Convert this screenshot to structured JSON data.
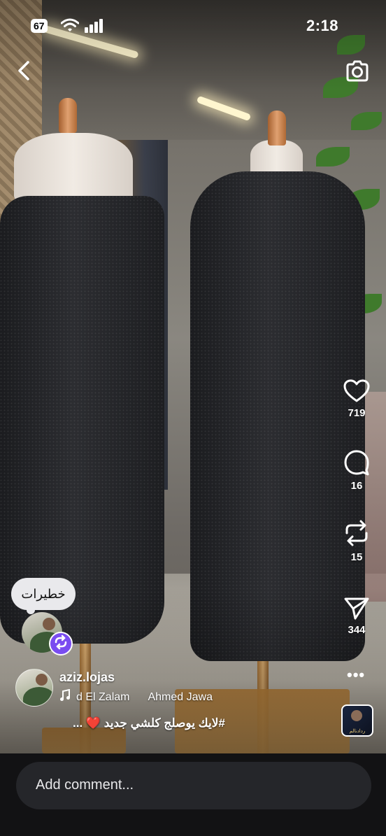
{
  "status_bar": {
    "battery": "67",
    "time": "2:18"
  },
  "top_bar": {
    "back_icon": "chevron-left-icon",
    "camera_icon": "camera-icon"
  },
  "actions": {
    "likes": "719",
    "comments": "16",
    "reposts": "15",
    "shares": "344"
  },
  "note": {
    "text": "خطيرات"
  },
  "author": {
    "username": "aziz.lojas"
  },
  "audio": {
    "segments": [
      "d El Zalam",
      "Ahmed Jawa"
    ],
    "thumb_text": "ردادنالم"
  },
  "caption": {
    "text": "#لايك يوصلج كلشي جديد ❤️ ..."
  },
  "comment": {
    "placeholder": "Add comment..."
  },
  "colors": {
    "remix_badge": "#7a4cf0",
    "comment_bar": "#121214",
    "comment_input": "#25262a"
  }
}
